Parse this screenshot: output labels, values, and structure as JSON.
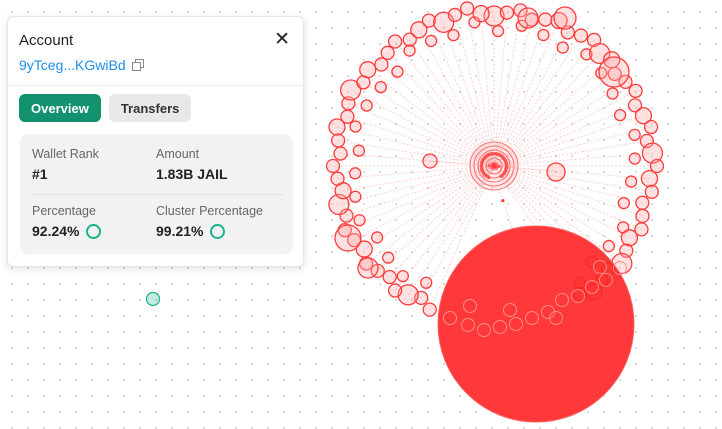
{
  "account": {
    "title": "Account",
    "close_icon": "close-icon",
    "address": "9yTceg...KGwiBd",
    "copy_icon": "copy-icon"
  },
  "tabs": [
    {
      "label": "Overview",
      "active": true
    },
    {
      "label": "Transfers",
      "active": false
    }
  ],
  "stats": {
    "wallet_rank_label": "Wallet Rank",
    "wallet_rank_value": "#1",
    "amount_label": "Amount",
    "amount_value": "1.83B JAIL",
    "percentage_label": "Percentage",
    "percentage_value": "92.24%",
    "cluster_percentage_label": "Cluster Percentage",
    "cluster_percentage_value": "99.21%"
  },
  "colors": {
    "accent": "#12926f",
    "link": "#1f8ee8",
    "node": "#ff3b3b",
    "ring": "#1ab38a"
  }
}
